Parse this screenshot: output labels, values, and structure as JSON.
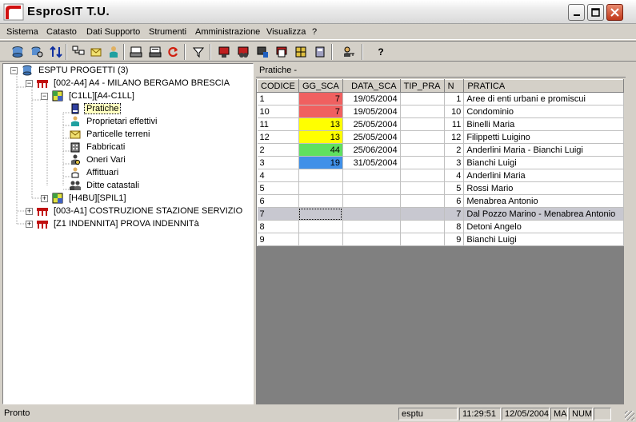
{
  "window": {
    "title": "EsproSIT T.U."
  },
  "menu": [
    {
      "label": "Sistema"
    },
    {
      "label": "Catasto"
    },
    {
      "label": "Dati Supporto"
    },
    {
      "label": "Strumenti"
    },
    {
      "label": "Amministrazione"
    },
    {
      "label": "Visualizza"
    },
    {
      "label": "?"
    }
  ],
  "toolbar": {
    "help_label": "?"
  },
  "tree": {
    "root": "ESPTU PROGETTI (3)",
    "project1": "[002-A4] A4 - MILANO BERGAMO BRESCIA",
    "sub1": "[C1LL][A4-C1LL]",
    "leaves": [
      "Pratiche",
      "Proprietari effettivi",
      "Particelle terreni",
      "Fabbricati",
      "Oneri Vari",
      "Affittuari",
      "Ditte catastali"
    ],
    "sub2": "[H4BU][SPIL1]",
    "project2": "[003-A1] COSTRUZIONE STAZIONE SERVIZIO",
    "project3": "[Z1 INDENNITA] PROVA INDENNITà"
  },
  "panel": {
    "title": "Pratiche -"
  },
  "grid": {
    "columns": [
      "CODICE",
      "GG_SCA",
      "DATA_SCA",
      "TIP_PRA",
      "N",
      "PRATICA"
    ],
    "rows": [
      {
        "codice": "1",
        "gg": "7",
        "data": "19/05/2004",
        "tip": "",
        "n": "1",
        "pratica": "Aree di enti urbani e promiscui",
        "color": "#f06060"
      },
      {
        "codice": "10",
        "gg": "7",
        "data": "19/05/2004",
        "tip": "",
        "n": "10",
        "pratica": "Condominio",
        "color": "#f06060"
      },
      {
        "codice": "11",
        "gg": "13",
        "data": "25/05/2004",
        "tip": "",
        "n": "11",
        "pratica": "Binelli Maria",
        "color": "#ffff00"
      },
      {
        "codice": "12",
        "gg": "13",
        "data": "25/05/2004",
        "tip": "",
        "n": "12",
        "pratica": "Filippetti Luigino",
        "color": "#ffff00"
      },
      {
        "codice": "2",
        "gg": "44",
        "data": "25/06/2004",
        "tip": "",
        "n": "2",
        "pratica": "Anderlini Maria - Bianchi Luigi",
        "color": "#60e060"
      },
      {
        "codice": "3",
        "gg": "19",
        "data": "31/05/2004",
        "tip": "",
        "n": "3",
        "pratica": "Bianchi Luigi",
        "color": "#4090e8"
      },
      {
        "codice": "4",
        "gg": "",
        "data": "",
        "tip": "",
        "n": "4",
        "pratica": "Anderlini Maria",
        "color": ""
      },
      {
        "codice": "5",
        "gg": "",
        "data": "",
        "tip": "",
        "n": "5",
        "pratica": "Rossi Mario",
        "color": ""
      },
      {
        "codice": "6",
        "gg": "",
        "data": "",
        "tip": "",
        "n": "6",
        "pratica": "Menabrea Antonio",
        "color": ""
      },
      {
        "codice": "7",
        "gg": "",
        "data": "",
        "tip": "",
        "n": "7",
        "pratica": "Dal Pozzo Marino - Menabrea Antonio",
        "color": ""
      },
      {
        "codice": "8",
        "gg": "",
        "data": "",
        "tip": "",
        "n": "8",
        "pratica": "Detoni Angelo",
        "color": ""
      },
      {
        "codice": "9",
        "gg": "",
        "data": "",
        "tip": "",
        "n": "9",
        "pratica": "Bianchi Luigi",
        "color": ""
      }
    ]
  },
  "status": {
    "text": "Pronto",
    "user": "esptu",
    "time": "11:29:51",
    "date": "12/05/2004",
    "ma": "MA",
    "num": "NUM"
  }
}
